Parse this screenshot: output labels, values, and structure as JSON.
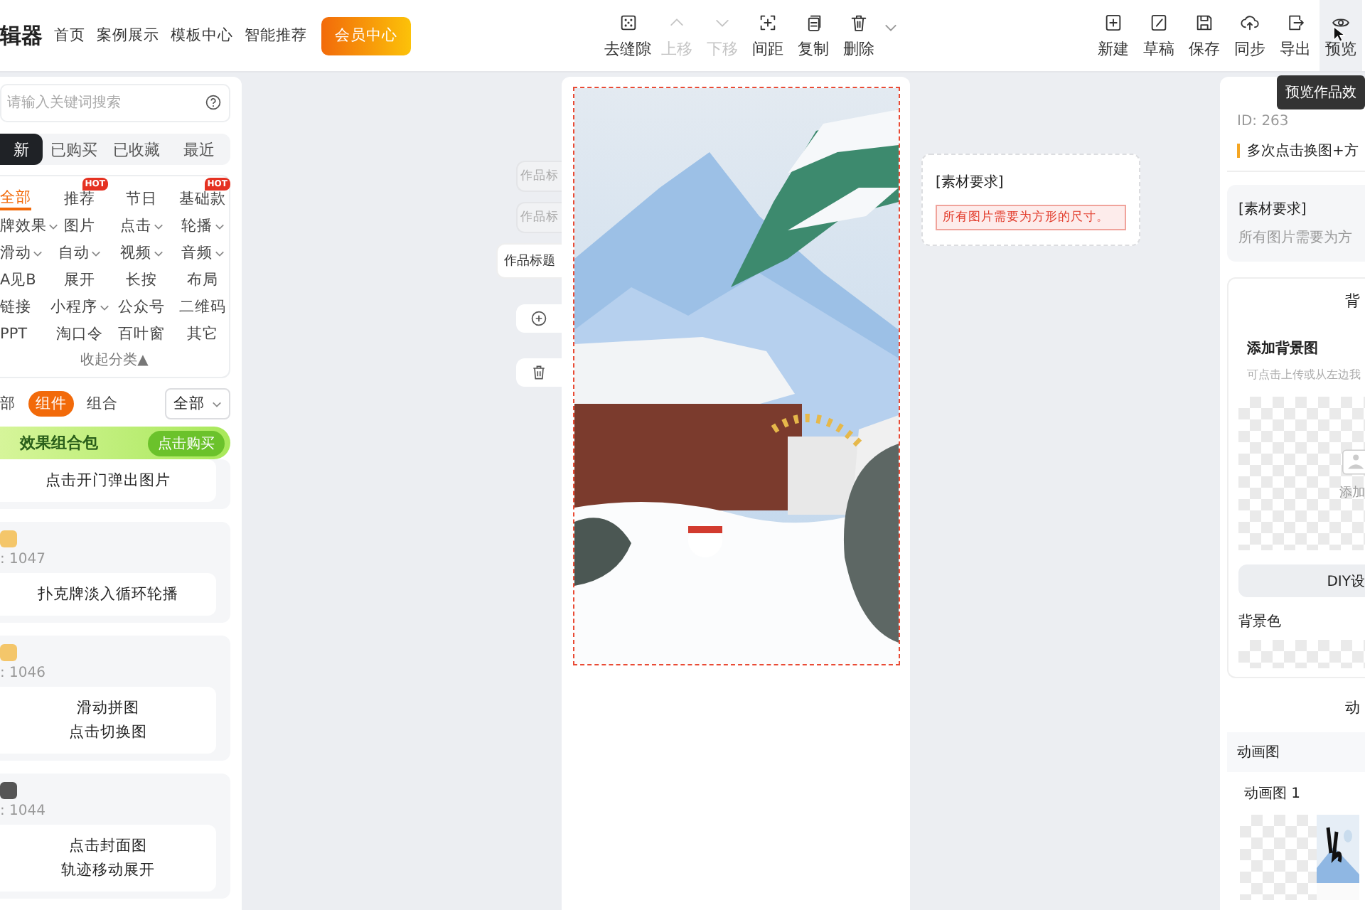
{
  "header": {
    "logo": "辑器",
    "nav": [
      "首页",
      "案例展示",
      "模板中心",
      "智能推荐"
    ],
    "vip_button": "会员中心"
  },
  "toolbar": {
    "edit_tools": [
      {
        "label": "去缝隙",
        "kind": "gap",
        "disabled": false
      },
      {
        "label": "上移",
        "kind": "up",
        "disabled": true
      },
      {
        "label": "下移",
        "kind": "down",
        "disabled": true
      },
      {
        "label": "间距",
        "kind": "spacing",
        "disabled": false
      },
      {
        "label": "复制",
        "kind": "copy",
        "disabled": false
      },
      {
        "label": "删除",
        "kind": "delete",
        "disabled": false
      }
    ],
    "file_tools": [
      {
        "label": "新建",
        "kind": "new",
        "hovered": false
      },
      {
        "label": "草稿",
        "kind": "draft",
        "hovered": false
      },
      {
        "label": "保存",
        "kind": "save",
        "hovered": false
      },
      {
        "label": "同步",
        "kind": "sync",
        "hovered": false
      },
      {
        "label": "导出",
        "kind": "export",
        "hovered": false
      },
      {
        "label": "预览",
        "kind": "preview",
        "hovered": true
      }
    ],
    "tooltip": "预览作品效"
  },
  "left": {
    "search": {
      "placeholder": "请输入关键词搜索"
    },
    "tabs": [
      {
        "label": "新",
        "selected": true
      },
      {
        "label": "已购买",
        "selected": false
      },
      {
        "label": "已收藏",
        "selected": false
      },
      {
        "label": "最近",
        "selected": false
      }
    ],
    "categories": [
      {
        "label": "全部",
        "selected": true,
        "dropdown": false
      },
      {
        "label": "推荐",
        "selected": false,
        "badge": "HOT",
        "dropdown": false
      },
      {
        "label": "节日",
        "selected": false,
        "dropdown": false
      },
      {
        "label": "基础款",
        "selected": false,
        "badge": "HOT",
        "dropdown": false
      },
      {
        "label": "牌效果",
        "selected": false,
        "dropdown": true
      },
      {
        "label": "图片",
        "selected": false,
        "dropdown": false
      },
      {
        "label": "点击",
        "selected": false,
        "dropdown": true
      },
      {
        "label": "轮播",
        "selected": false,
        "dropdown": true
      },
      {
        "label": "滑动",
        "selected": false,
        "dropdown": true
      },
      {
        "label": "自动",
        "selected": false,
        "dropdown": true
      },
      {
        "label": "视频",
        "selected": false,
        "dropdown": true
      },
      {
        "label": "音频",
        "selected": false,
        "dropdown": true
      },
      {
        "label": "A见B",
        "selected": false,
        "dropdown": false
      },
      {
        "label": "展开",
        "selected": false,
        "dropdown": false
      },
      {
        "label": "长按",
        "selected": false,
        "dropdown": false
      },
      {
        "label": "布局",
        "selected": false,
        "dropdown": false
      },
      {
        "label": "链接",
        "selected": false,
        "dropdown": false
      },
      {
        "label": "小程序",
        "selected": false,
        "dropdown": true
      },
      {
        "label": "公众号",
        "selected": false,
        "dropdown": false
      },
      {
        "label": "二维码",
        "selected": false,
        "dropdown": false
      },
      {
        "label": "PPT",
        "selected": false,
        "dropdown": false
      },
      {
        "label": "淘口令",
        "selected": false,
        "dropdown": false
      },
      {
        "label": "百叶窗",
        "selected": false,
        "dropdown": false
      },
      {
        "label": "其它",
        "selected": false,
        "dropdown": false
      }
    ],
    "collapse": "收起分类▲",
    "filters": [
      {
        "label": "部",
        "selected": false
      },
      {
        "label": "组件",
        "selected": true
      },
      {
        "label": "组合",
        "selected": false
      }
    ],
    "filter_select": "全部",
    "banner": {
      "title": "效果组合包",
      "button": "点击购买"
    },
    "cards": [
      {
        "lines": [
          "点击开门弹出图片"
        ]
      },
      {
        "id": ": 1047",
        "color": "#f4c66a",
        "lines": [
          "扑克牌淡入循环轮播"
        ]
      },
      {
        "id": ": 1046",
        "color": "#f4c66a",
        "lines": [
          "滑动拼图",
          "点击切换图"
        ]
      },
      {
        "id": ": 1044",
        "color": "#555555",
        "lines": [
          "点击封面图",
          "轨迹移动展开"
        ]
      }
    ]
  },
  "canvas": {
    "side_tabs": [
      {
        "label": "作品标",
        "selected": false
      },
      {
        "label": "作品标",
        "selected": false
      },
      {
        "label": "作品标题",
        "selected": true
      }
    ],
    "requirement": {
      "title": "[素材要求]",
      "text": "所有图片需要为方形的尺寸。"
    }
  },
  "right": {
    "id": "ID: 263",
    "note": "多次点击换图+方",
    "requirement": {
      "title": "[素材要求]",
      "text": "所有图片需要为方"
    },
    "background": {
      "title": "背",
      "add_title": "添加背景图",
      "hint": "可点击上传或从左边我",
      "upload": "添加",
      "diy_button": "DIY设",
      "color_label": "背景色"
    },
    "animation": {
      "title": "动",
      "row": "动画图",
      "item": "动画图 1"
    }
  }
}
